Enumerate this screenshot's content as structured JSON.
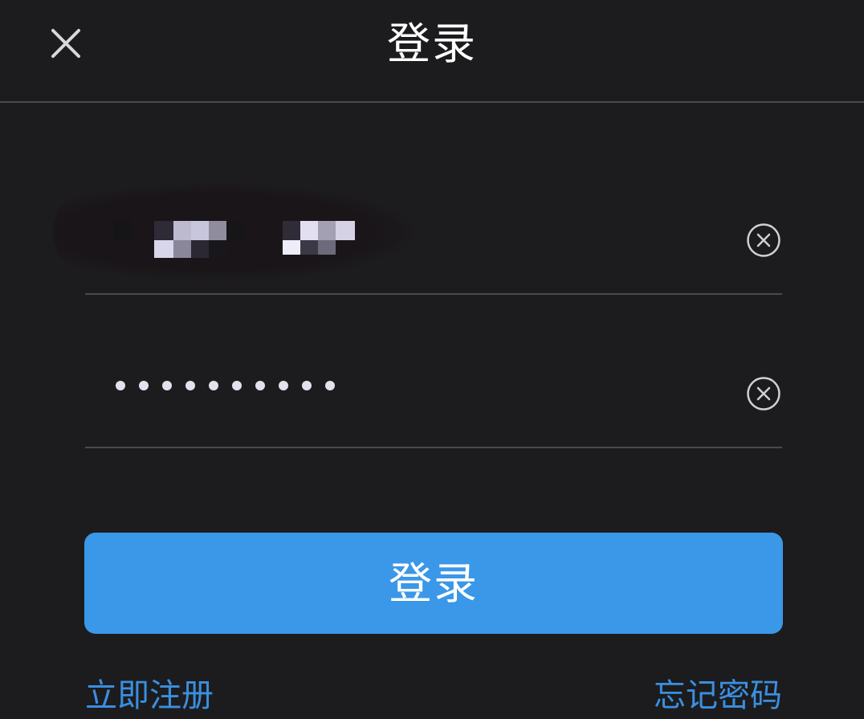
{
  "header": {
    "title": "登录",
    "close_icon": "close-icon"
  },
  "form": {
    "username": {
      "value": "",
      "clear_icon": "clear-circle-icon"
    },
    "password": {
      "masked_value": "••••••••••",
      "length": 10,
      "clear_icon": "clear-circle-icon"
    }
  },
  "actions": {
    "login_label": "登录",
    "register_label": "立即注册",
    "forgot_label": "忘记密码"
  },
  "colors": {
    "background": "#1c1c1e",
    "accent": "#3b97e7",
    "link": "#3a8fe0",
    "divider": "#4a4a4c"
  }
}
